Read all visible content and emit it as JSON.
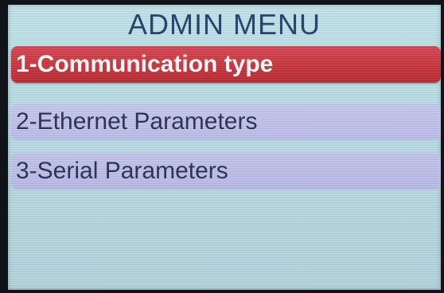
{
  "screen": {
    "title": "ADMIN MENU"
  },
  "menu": {
    "items": [
      {
        "label": "1-Communication type",
        "selected": true
      },
      {
        "label": "2-Ethernet Parameters",
        "selected": false
      },
      {
        "label": "3-Serial Parameters",
        "selected": false
      }
    ]
  },
  "colors": {
    "selected_background": "#c82e36",
    "unselected_background": "#c0bfec",
    "screen_background": "#b9dbe3",
    "title_text": "#1d3a66"
  }
}
